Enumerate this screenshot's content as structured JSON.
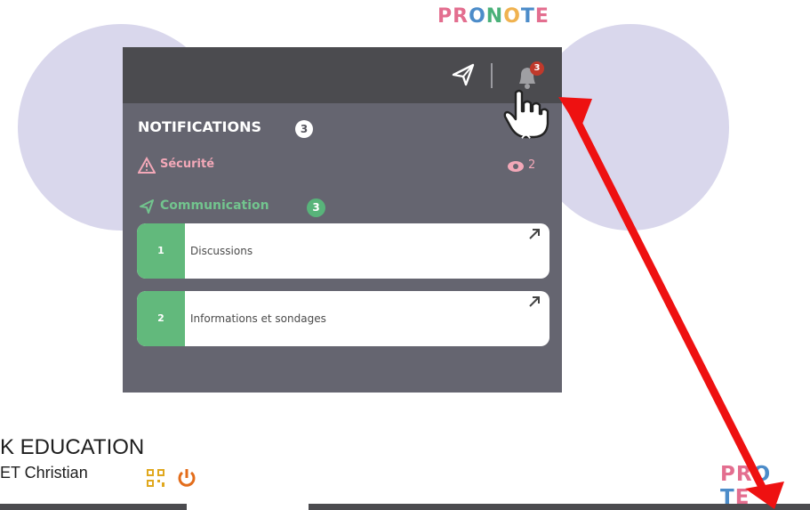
{
  "brand": {
    "logo_letters": [
      "P",
      "R",
      "O",
      "N",
      "O",
      "T",
      "E"
    ],
    "logo_colors": [
      "#e36e8f",
      "#e36e8f",
      "#4c8cc9",
      "#4ab179",
      "#f0b24f",
      "#4c8cc9",
      "#e36e8f"
    ],
    "bottom_logo_letters": [
      "P",
      "R",
      "O",
      "",
      "",
      "T",
      "E"
    ]
  },
  "header": {
    "notification_badge": "3"
  },
  "notifications": {
    "title": "NOTIFICATIONS",
    "count": "3",
    "close_symbol": "✕",
    "security": {
      "label": "Sécurité",
      "view_count": "2"
    },
    "communication": {
      "label": "Communication",
      "count": "3",
      "items": [
        {
          "count": "1",
          "label": "Discussions"
        },
        {
          "count": "2",
          "label": "Informations et sondages"
        }
      ]
    }
  },
  "footer": {
    "school_text": "K EDUCATION",
    "user_text": "ET Christian"
  },
  "colors": {
    "panel_bg": "#656570",
    "header_bg": "#4b4b4f",
    "accent_green": "#62b97c",
    "warning_pink": "#f3a8b8",
    "annotation_red": "#ee1111",
    "circle_lavender": "#d9d7ec"
  },
  "icons": {
    "send": "paper-plane-icon",
    "bell": "bell-icon",
    "cursor": "hand-cursor-icon",
    "warning": "warning-triangle-icon",
    "eye": "eye-icon",
    "external": "external-link-arrow-icon",
    "qr": "qr-code-icon",
    "power": "power-icon"
  }
}
